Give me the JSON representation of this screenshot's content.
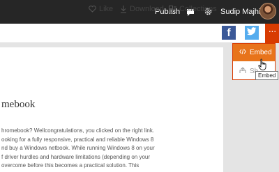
{
  "topbar": {
    "publish_label": "Publish",
    "username": "Sudip Majhi",
    "icons": [
      "chat-icon",
      "gear-icon"
    ]
  },
  "actions": {
    "like_label": "Like",
    "download_label": "Download",
    "collections_label": "Collections",
    "facebook_letter": "f",
    "more_label": "···"
  },
  "document": {
    "heading": "mebook",
    "paragraph_lines": [
      "hromebook? Wellcongratulations, you clicked on the right link.",
      "ooking for a fully responsive, practical and reliable Windows 8",
      "nd buy a Windows netbook. While running Windows 8 on your",
      "f driver hurdles and hardware limitations (depending on your",
      "overcome before this becomes a practical solution. This"
    ]
  },
  "embed_menu": {
    "embed_label": "Embed",
    "share_label": "Sh",
    "tooltip": "Embed"
  },
  "colors": {
    "topbar": "#262626",
    "accent": "#d83b01",
    "embed_highlight": "#e8741b",
    "facebook": "#3b5998",
    "twitter": "#55acee"
  }
}
